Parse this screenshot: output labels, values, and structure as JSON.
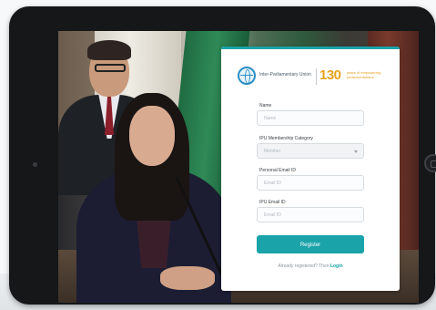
{
  "logo": {
    "org_name": "Inter-Parliamentary Union",
    "anniversary_number": "130",
    "anniversary_text": "years of empowering parliamentarians"
  },
  "form": {
    "name": {
      "label": "Name",
      "placeholder": "Name"
    },
    "membership": {
      "label": "IPU Membership Category",
      "selected": "Member"
    },
    "personal_email": {
      "label": "Personal Email ID",
      "placeholder": "Email ID"
    },
    "ipu_email": {
      "label": "IPU Email ID",
      "placeholder": "Email ID"
    },
    "register_label": "Register",
    "login_prompt": "Already registered? Then",
    "login_link": "Login"
  },
  "colors": {
    "accent": "#1aa3a8",
    "anniversary": "#e8a21c",
    "tablet_bezel": "#151719"
  }
}
